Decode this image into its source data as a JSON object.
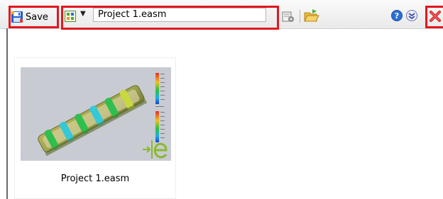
{
  "toolbar": {
    "save_label": "Save",
    "project_field_value": "Project 1.easm",
    "icons": {
      "save": "floppy-disk-icon",
      "project": "project-icon",
      "dropdown": "chevron-down-icon",
      "settings": "document-settings-icon",
      "open_folder": "open-folder-icon",
      "help": "help-icon",
      "expand": "expand-icon",
      "close": "close-icon"
    }
  },
  "document_card": {
    "label": "Project 1.easm",
    "thumbnail": "simulation-thumbnail"
  },
  "colors": {
    "highlight": "#e3171e",
    "accent_blue": "#1e5fd0"
  }
}
